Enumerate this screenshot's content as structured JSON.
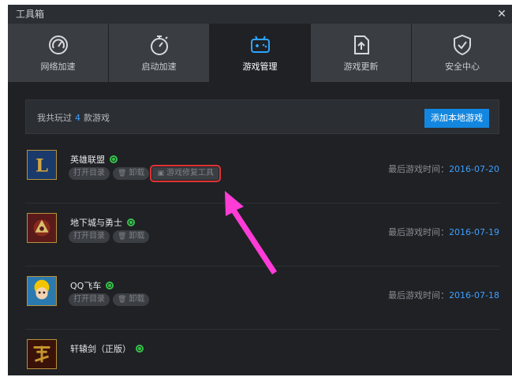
{
  "window": {
    "title": "工具箱"
  },
  "tabs": [
    {
      "label": "网络加速",
      "icon": "speedometer-icon"
    },
    {
      "label": "启动加速",
      "icon": "stopwatch-icon"
    },
    {
      "label": "游戏管理",
      "icon": "gamepad-icon",
      "active": true
    },
    {
      "label": "游戏更新",
      "icon": "upload-arrow-icon"
    },
    {
      "label": "安全中心",
      "icon": "shield-check-icon"
    }
  ],
  "summary": {
    "prefix": "我共玩过",
    "count": "4",
    "suffix": "款游戏",
    "add_button": "添加本地游戏"
  },
  "buttons": {
    "open_dir": "打开目录",
    "uninstall": "卸载",
    "repair": "游戏修复工具"
  },
  "games": [
    {
      "name": "英雄联盟",
      "last_played_label": "最后游戏时间：",
      "last_played": "2016-07-20",
      "icon_colors": [
        "#1a3a6b",
        "#d4a640"
      ]
    },
    {
      "name": "地下城与勇士",
      "last_played_label": "最后游戏时间：",
      "last_played": "2016-07-19",
      "icon_colors": [
        "#5a1a1a",
        "#d9c070"
      ]
    },
    {
      "name": "QQ飞车",
      "last_played_label": "最后游戏时间：",
      "last_played": "2016-07-18",
      "icon_colors": [
        "#2a7ab0",
        "#f2c400"
      ]
    },
    {
      "name": "轩辕剑（正版）",
      "icon_colors": [
        "#3a1208",
        "#c8962e"
      ]
    }
  ],
  "colors": {
    "accent": "#1387e0",
    "highlight": "#e03333",
    "arrow": "#ff3cd6",
    "eye": "#36c24a"
  }
}
